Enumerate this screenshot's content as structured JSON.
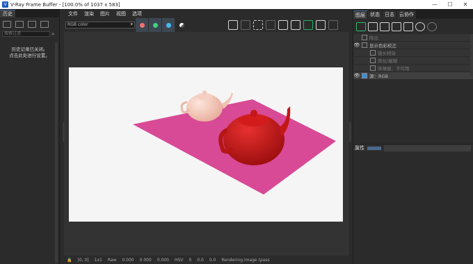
{
  "window": {
    "title": "V-Ray Frame Buffer - [100.0% of 1037 x 583]",
    "logo": "V",
    "minimize": "—",
    "maximize": "☐",
    "close": "✕"
  },
  "left_panel": {
    "tab": "历史",
    "search_placeholder": "搜索过滤",
    "message": "历史记录已关闭。\n点击此处进行设置。"
  },
  "menu": {
    "file": "文件",
    "render": "渲染",
    "image": "图片",
    "view": "视图",
    "options": "选项"
  },
  "toolbar": {
    "channel": "RGB color",
    "colors": {
      "red": "#f07072",
      "green": "#3fd27a",
      "blue": "#4cb8f0"
    }
  },
  "statusbar": {
    "coords": "[0, 0]",
    "zoom": "1x1",
    "mode": "Raw",
    "v1": "0.000",
    "v2": "0.000",
    "v3": "0.000",
    "color_mode": "HSV",
    "h": "0",
    "s": "0.0",
    "v": "0.0",
    "status": "Rendering image (pass"
  },
  "right_panel": {
    "tabs": [
      "图层",
      "状态",
      "日志",
      "云协作"
    ],
    "layers": [
      {
        "label": "降位",
        "eye": "",
        "dim": true
      },
      {
        "label": "显示色彩校正",
        "eye": "👁",
        "dim": false
      },
      {
        "label": "镜头特效",
        "eye": "",
        "dim": true
      },
      {
        "label": "简化/模糊",
        "eye": "",
        "dim": true
      },
      {
        "label": "降噪器：不可用",
        "eye": "",
        "dim": true
      },
      {
        "label": "源：RGB",
        "eye": "👁",
        "dim": false
      }
    ],
    "properties_label": "属性"
  },
  "render_scene": {
    "floor_color": "#d84a95",
    "teapot_small_color": "#f2c7b8",
    "teapot_large_color": "#cf1818"
  }
}
